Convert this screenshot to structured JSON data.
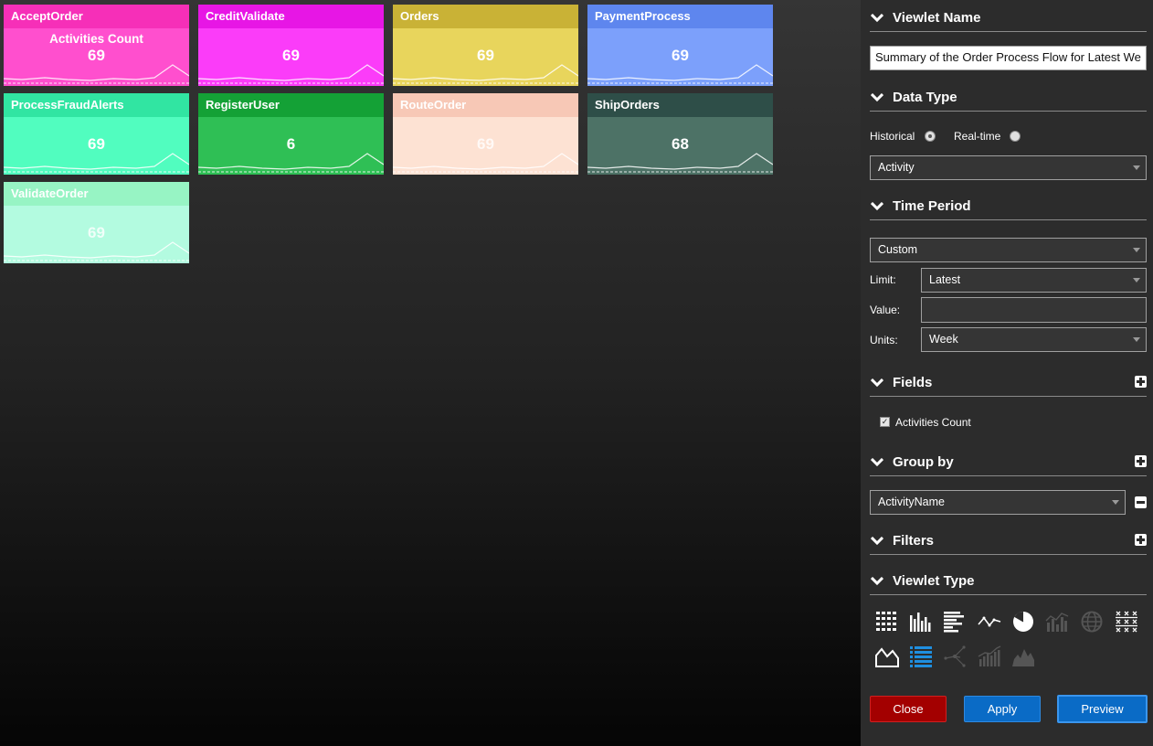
{
  "tiles": [
    {
      "name": "AcceptOrder",
      "field": "Activities Count",
      "value": "69",
      "head_color": "#f62fb8",
      "body_color": "#ff4fce",
      "faded": false
    },
    {
      "name": "CreditValidate",
      "field": "",
      "value": "69",
      "head_color": "#e716e5",
      "body_color": "#fb3cf9",
      "faded": false
    },
    {
      "name": "Orders",
      "field": "",
      "value": "69",
      "head_color": "#c9b236",
      "body_color": "#e8d55c",
      "faded": false
    },
    {
      "name": "PaymentProcess",
      "field": "",
      "value": "69",
      "head_color": "#5e86ee",
      "body_color": "#7ca0fb",
      "faded": false
    },
    {
      "name": "ProcessFraudAlerts",
      "field": "",
      "value": "69",
      "head_color": "#31e5a2",
      "body_color": "#51fdbf",
      "faded": false
    },
    {
      "name": "RegisterUser",
      "field": "",
      "value": "6",
      "head_color": "#14a136",
      "body_color": "#2fbf55",
      "faded": false
    },
    {
      "name": "RouteOrder",
      "field": "",
      "value": "69",
      "head_color": "#f7c8b6",
      "body_color": "#fde2d3",
      "faded": true
    },
    {
      "name": "ShipOrders",
      "field": "",
      "value": "68",
      "head_color": "#2e4e48",
      "body_color": "#4d7266",
      "faded": false
    },
    {
      "name": "ValidateOrder",
      "field": "",
      "value": "69",
      "head_color": "#97f4c4",
      "body_color": "#b3fbe0",
      "faded": true
    }
  ],
  "panel": {
    "viewlet_name": {
      "title": "Viewlet Name",
      "value": "Summary of the Order Process Flow for Latest We"
    },
    "data_type": {
      "title": "Data Type",
      "historical": "Historical",
      "realtime": "Real-time",
      "selected": "Historical",
      "select_value": "Activity"
    },
    "time_period": {
      "title": "Time Period",
      "mode": "Custom",
      "limit_label": "Limit:",
      "limit_value": "Latest",
      "value_label": "Value:",
      "value_value": "",
      "units_label": "Units:",
      "units_value": "Week"
    },
    "fields": {
      "title": "Fields",
      "items": [
        {
          "label": "Activities Count",
          "checked": true
        }
      ]
    },
    "group_by": {
      "title": "Group by",
      "value": "ActivityName"
    },
    "filters": {
      "title": "Filters"
    },
    "viewlet_type": {
      "title": "Viewlet Type",
      "icons": [
        "table-grid-icon",
        "column-chart-icon",
        "bar-chart-icon",
        "line-chart-icon",
        "pie-chart-icon",
        "combo-chart-icon",
        "globe-map-icon",
        "scatter-matrix-icon",
        "area-chart-icon",
        "list-icon",
        "network-icon",
        "column-line-icon",
        "mountain-chart-icon"
      ]
    },
    "buttons": {
      "close": "Close",
      "apply": "Apply",
      "preview": "Preview"
    }
  },
  "colors": {
    "close": "#a30000",
    "apply": "#0a6bc6",
    "panel_bg": "#2c2c2c",
    "icon_active_blue": "#1f8fe0"
  }
}
